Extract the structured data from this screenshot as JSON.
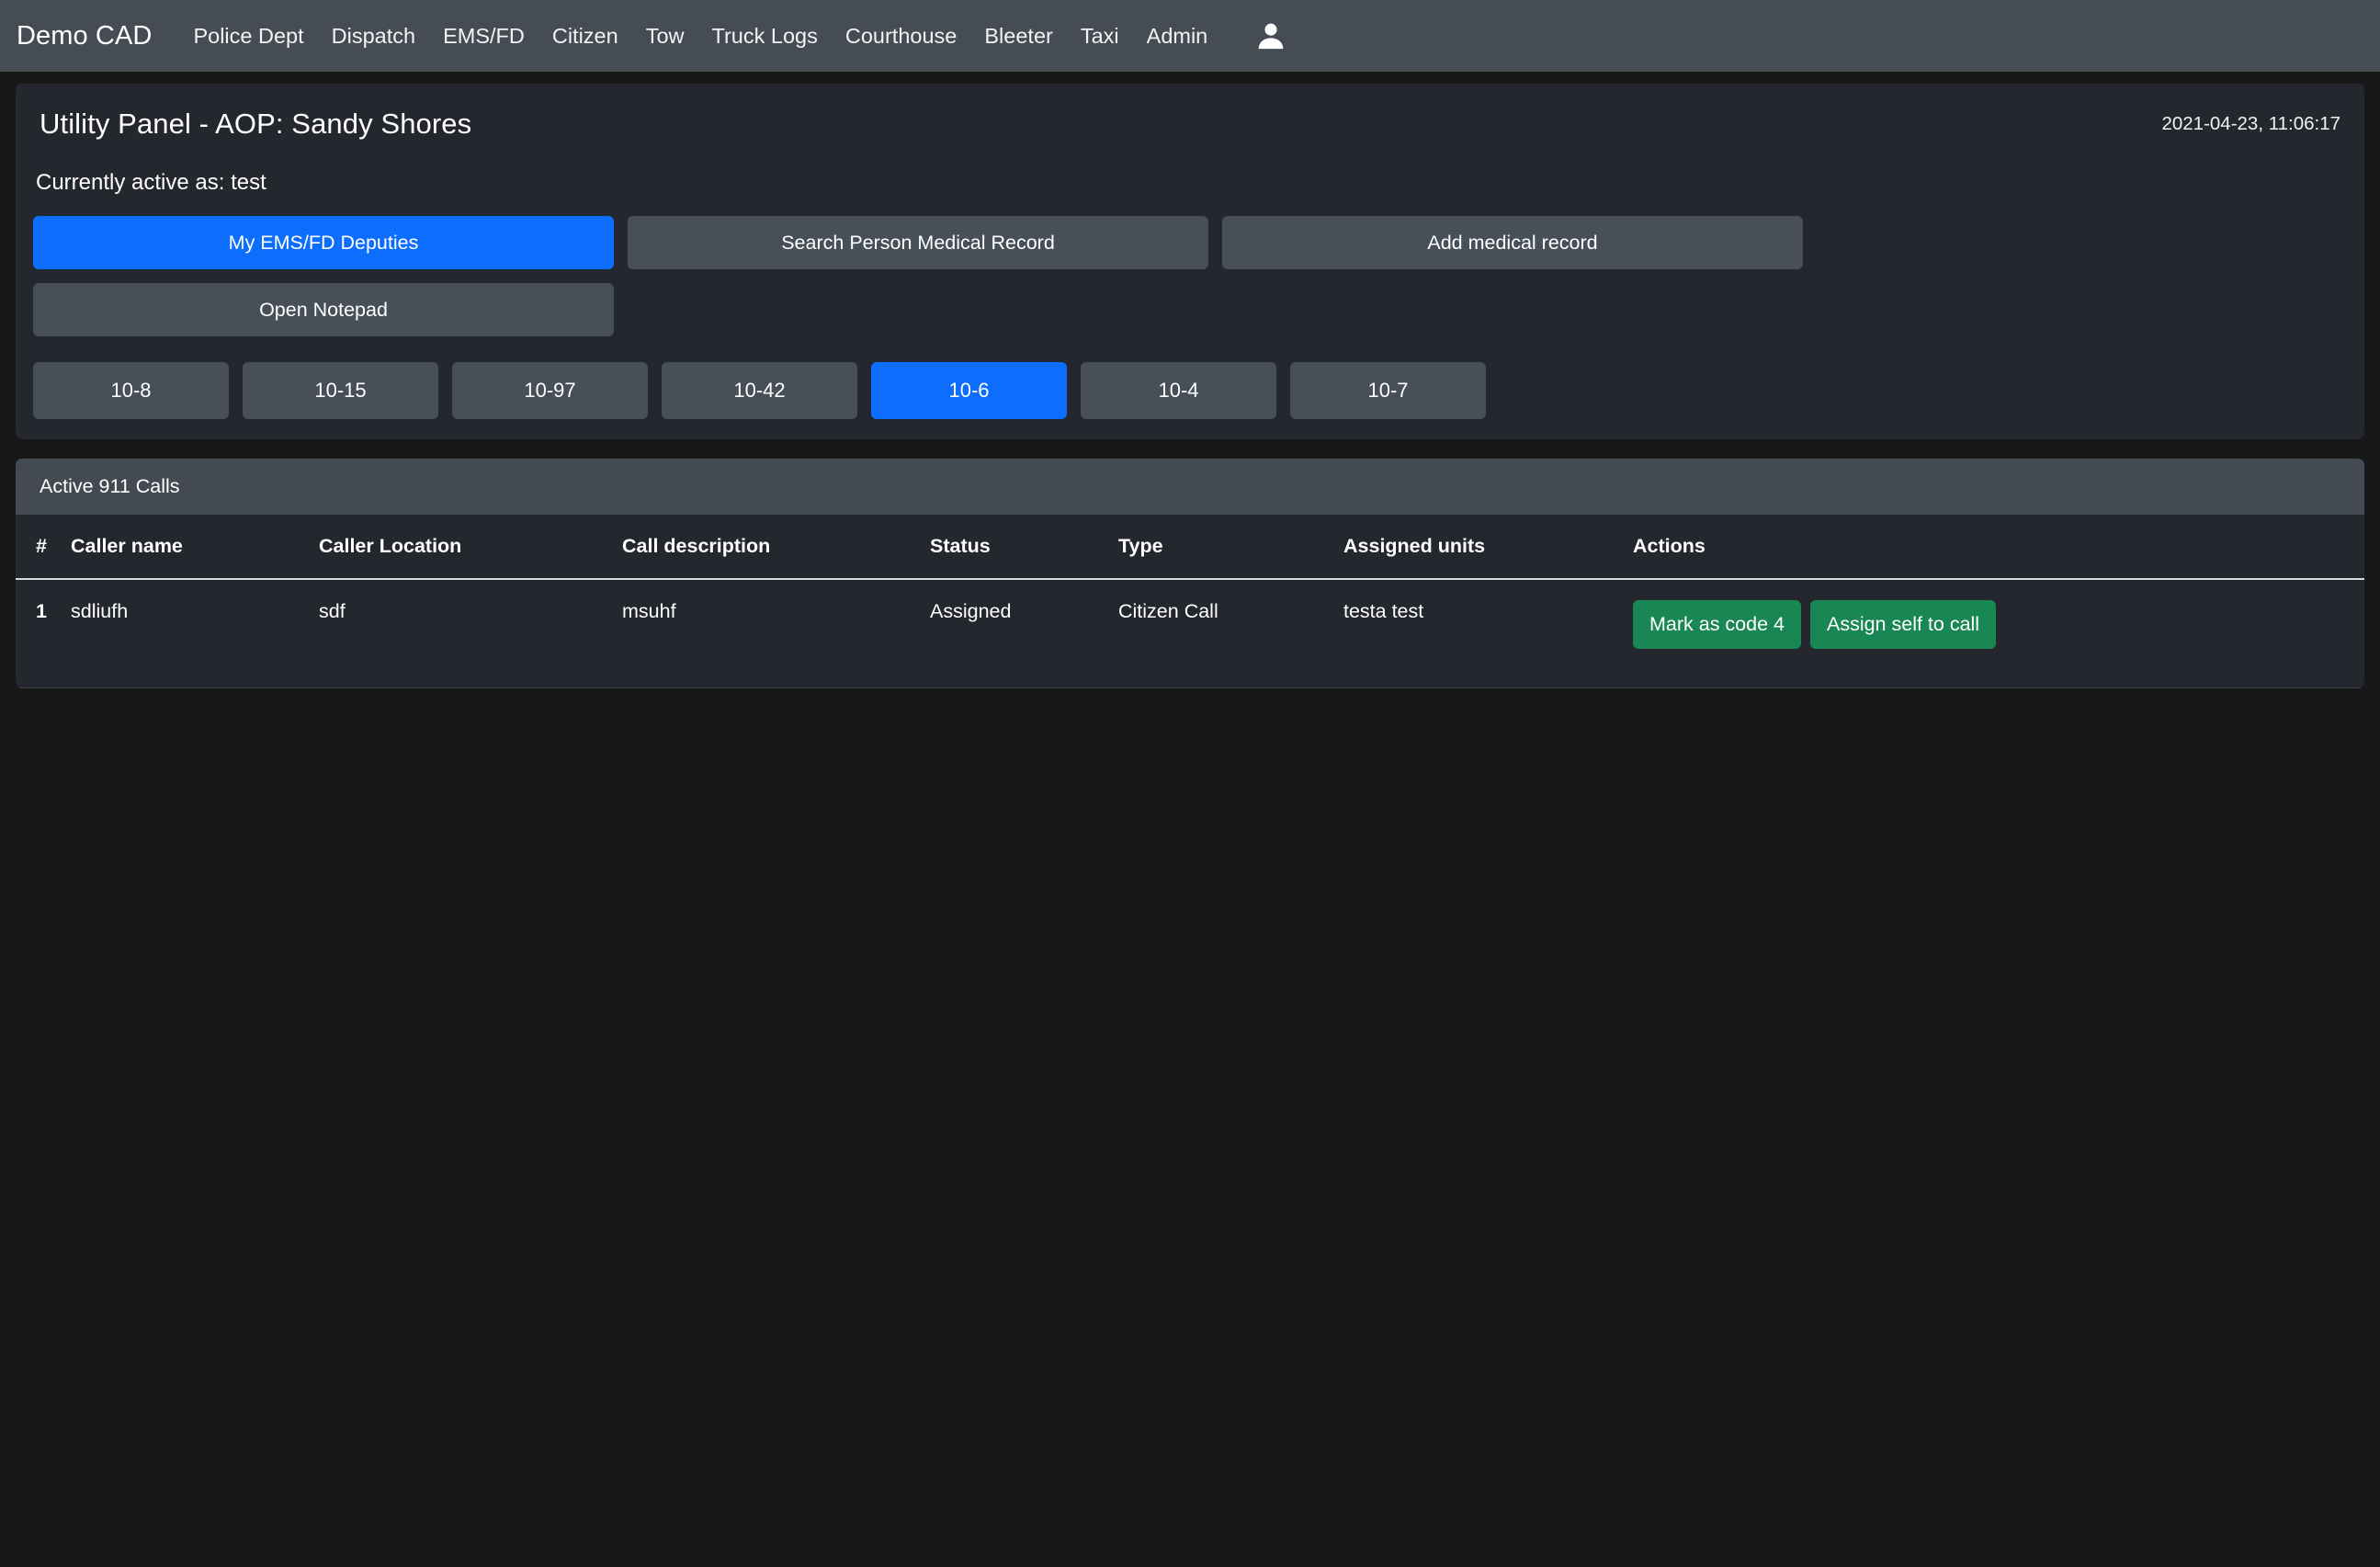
{
  "navbar": {
    "brand": "Demo CAD",
    "links": [
      {
        "label": "Police Dept"
      },
      {
        "label": "Dispatch"
      },
      {
        "label": "EMS/FD"
      },
      {
        "label": "Citizen"
      },
      {
        "label": "Tow"
      },
      {
        "label": "Truck Logs"
      },
      {
        "label": "Courthouse"
      },
      {
        "label": "Bleeter"
      },
      {
        "label": "Taxi"
      },
      {
        "label": "Admin"
      }
    ],
    "avatar_icon": "user-icon"
  },
  "panel": {
    "title": "Utility Panel - AOP: Sandy Shores",
    "timestamp": "2021-04-23, 11:06:17",
    "active_as": "Currently active as: test",
    "actions": [
      {
        "label": "My EMS/FD Deputies",
        "style": "primary"
      },
      {
        "label": "Search Person Medical Record",
        "style": "secondary"
      },
      {
        "label": "Add medical record",
        "style": "secondary"
      },
      {
        "label": "Open Notepad",
        "style": "secondary"
      }
    ],
    "status_codes": [
      {
        "label": "10-8",
        "active": false
      },
      {
        "label": "10-15",
        "active": false
      },
      {
        "label": "10-97",
        "active": false
      },
      {
        "label": "10-42",
        "active": false
      },
      {
        "label": "10-6",
        "active": true
      },
      {
        "label": "10-4",
        "active": false
      },
      {
        "label": "10-7",
        "active": false
      }
    ]
  },
  "calls": {
    "heading": "Active 911 Calls",
    "columns": [
      "#",
      "Caller name",
      "Caller Location",
      "Call description",
      "Status",
      "Type",
      "Assigned units",
      "Actions"
    ],
    "rows": [
      {
        "num": "1",
        "caller_name": "sdliufh",
        "caller_location": "sdf",
        "call_description": "msuhf",
        "status": "Assigned",
        "type": "Citizen Call",
        "assigned_units": "testa test",
        "actions": [
          {
            "label": "Mark as code 4"
          },
          {
            "label": "Assign self to call"
          }
        ]
      }
    ]
  },
  "colors": {
    "navbar_bg": "#454c54",
    "page_bg": "#181818",
    "card_bg": "#24272e",
    "primary": "#0d6efd",
    "secondary": "#474f58",
    "success": "#198754",
    "table_head_bg": "#434a52"
  }
}
